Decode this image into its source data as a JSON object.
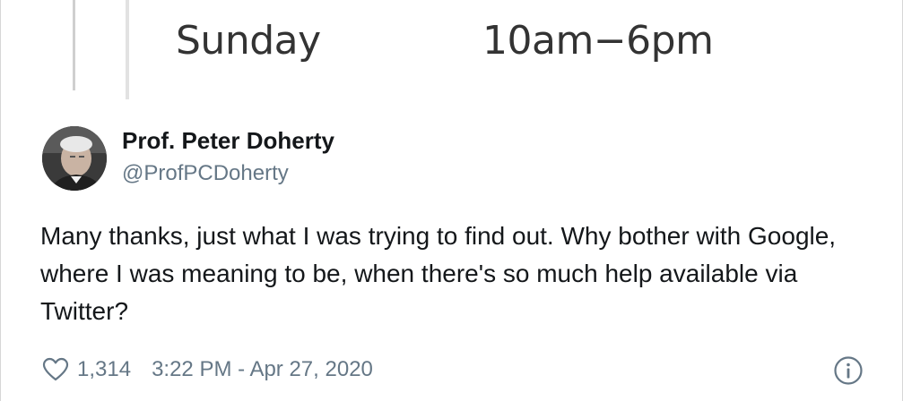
{
  "hours": {
    "day": "Sunday",
    "time": "10am−6pm"
  },
  "author": {
    "name": "Prof. Peter Doherty",
    "handle": "@ProfPCDoherty",
    "avatar_icon": "profile-photo"
  },
  "tweet": {
    "text": "Many thanks, just what I was trying to find out. Why bother with Google, where I was meaning to be, when there's so much help available via Twitter?"
  },
  "footer": {
    "like_icon": "heart-outline-icon",
    "like_count": "1,314",
    "timestamp": "3:22 PM - Apr 27, 2020",
    "info_icon": "info-icon"
  },
  "colors": {
    "text_primary": "#14171a",
    "text_secondary": "#657786",
    "hours_text": "#333333"
  }
}
